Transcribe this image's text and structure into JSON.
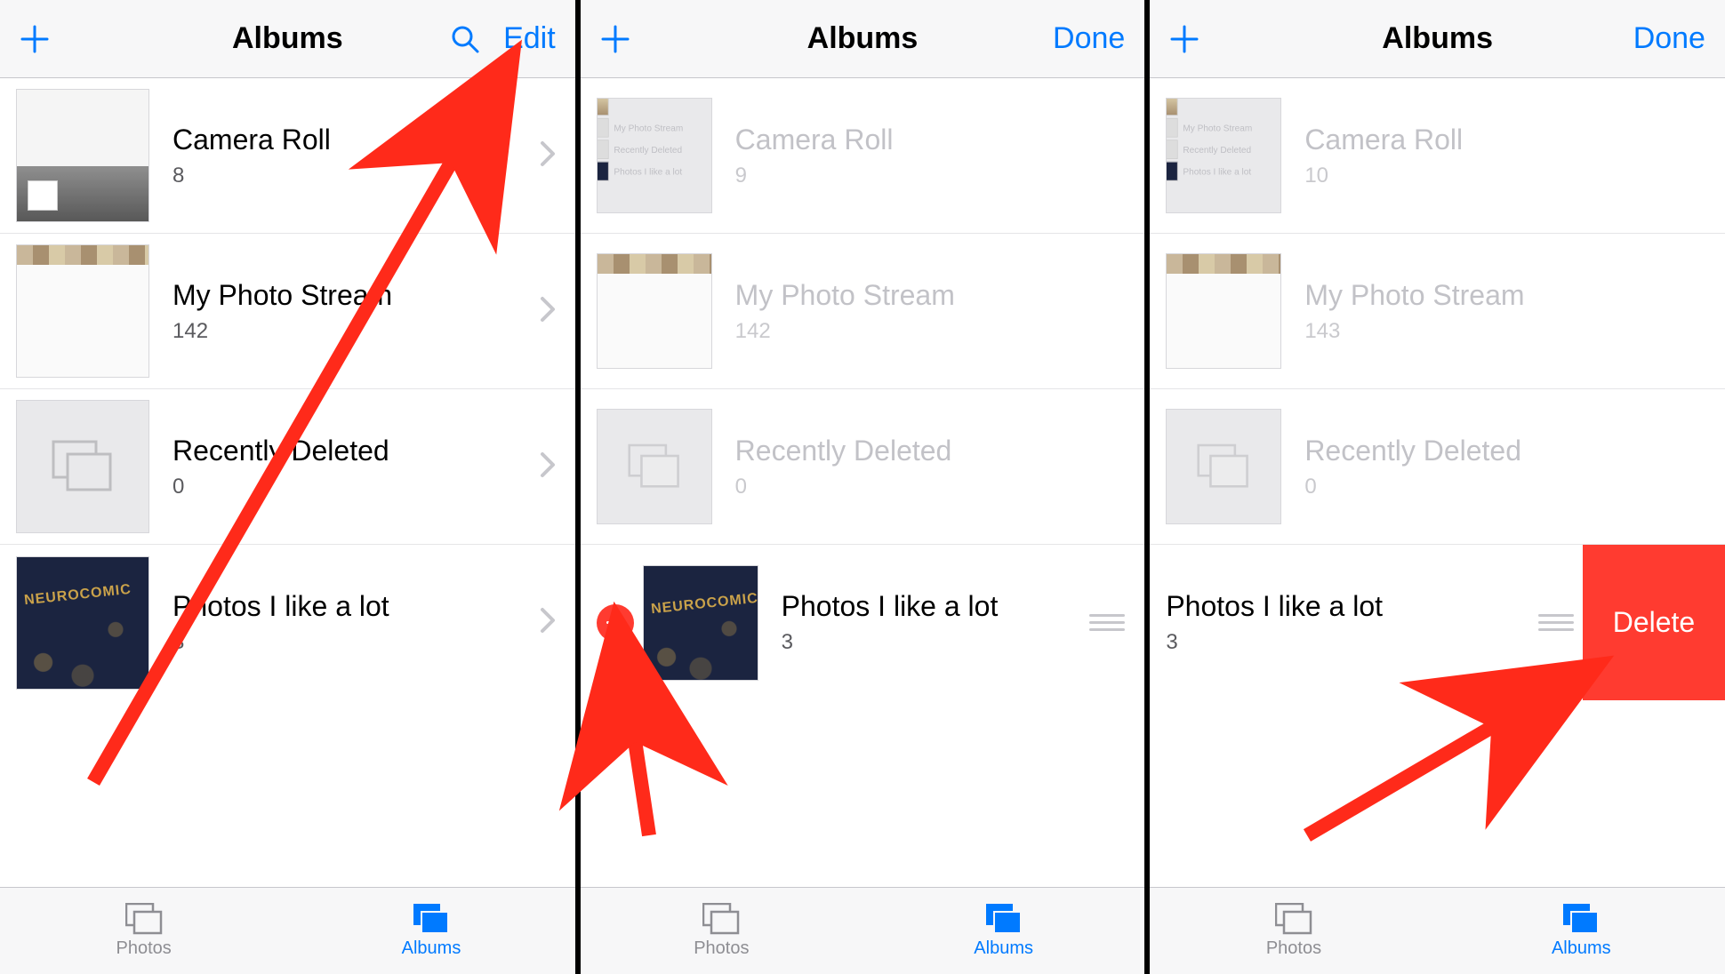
{
  "colors": {
    "accent": "#007aff",
    "destructive": "#ff3b30"
  },
  "screens": [
    {
      "nav": {
        "title": "Albums",
        "left_action": "add",
        "right_actions": [
          "search",
          "edit"
        ],
        "edit_label": "Edit"
      },
      "albums": [
        {
          "title": "Camera Roll",
          "count": "8"
        },
        {
          "title": "My Photo Stream",
          "count": "142"
        },
        {
          "title": "Recently Deleted",
          "count": "0"
        },
        {
          "title": "Photos I like a lot",
          "count": "3"
        }
      ],
      "tabs": {
        "photos": "Photos",
        "albums": "Albums",
        "active": "albums"
      }
    },
    {
      "nav": {
        "title": "Albums",
        "left_action": "add",
        "right_actions": [
          "done"
        ],
        "done_label": "Done"
      },
      "mini_labels": {
        "stream": "My Photo Stream",
        "deleted": "Recently Deleted",
        "like": "Photos I like a lot"
      },
      "albums": [
        {
          "title": "Camera Roll",
          "count": "9"
        },
        {
          "title": "My Photo Stream",
          "count": "142"
        },
        {
          "title": "Recently Deleted",
          "count": "0"
        },
        {
          "title": "Photos I like a lot",
          "count": "3"
        }
      ],
      "tabs": {
        "photos": "Photos",
        "albums": "Albums",
        "active": "albums"
      }
    },
    {
      "nav": {
        "title": "Albums",
        "left_action": "add",
        "right_actions": [
          "done"
        ],
        "done_label": "Done"
      },
      "mini_labels": {
        "stream": "My Photo Stream",
        "deleted": "Recently Deleted",
        "like": "Photos I like a lot"
      },
      "albums": [
        {
          "title": "Camera Roll",
          "count": "10"
        },
        {
          "title": "My Photo Stream",
          "count": "143"
        },
        {
          "title": "Recently Deleted",
          "count": "0"
        },
        {
          "title": "Photos I like a lot",
          "count": "3"
        }
      ],
      "delete_label": "Delete",
      "tabs": {
        "photos": "Photos",
        "albums": "Albums",
        "active": "albums"
      }
    }
  ]
}
